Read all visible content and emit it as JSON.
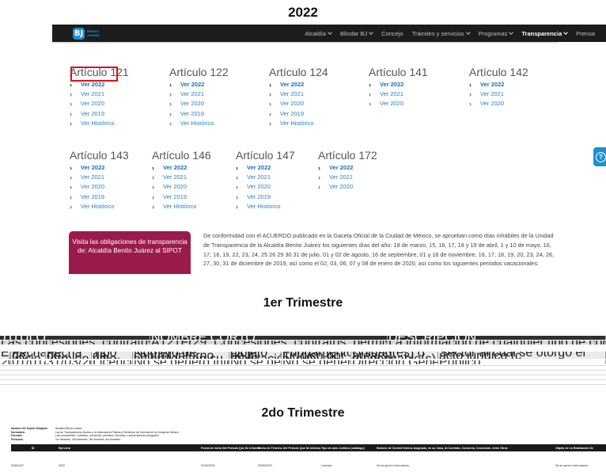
{
  "page": {
    "year_title": "2022"
  },
  "navbar": {
    "logo_mark": "BJ",
    "logo_text": "BENITO\nJUÁREZ",
    "items": [
      {
        "label": "Alcaldía",
        "dropdown": true
      },
      {
        "label": "Blindar BJ",
        "dropdown": true
      },
      {
        "label": "Concejo",
        "dropdown": false
      },
      {
        "label": "Trámites y servicios",
        "dropdown": true
      },
      {
        "label": "Programas",
        "dropdown": true
      },
      {
        "label": "Transparencia",
        "dropdown": true,
        "active": true
      },
      {
        "label": "Prensa",
        "dropdown": false
      }
    ]
  },
  "articles": [
    {
      "title": "Artículo 121",
      "links": [
        "Ver 2022",
        "Ver 2021",
        "Ver 2020",
        "Ver 2019",
        "Ver Histórico"
      ]
    },
    {
      "title": "Artículo 122",
      "links": [
        "Ver 2022",
        "Ver 2021",
        "Ver 2020",
        "Ver 2019",
        "Ver Histórico"
      ]
    },
    {
      "title": "Artículo 124",
      "links": [
        "Ver 2022",
        "Ver 2021",
        "Ver 2020",
        "Ver 2019",
        "Ver Histórico"
      ]
    },
    {
      "title": "Artículo 141",
      "links": [
        "Ver 2022",
        "Ver 2021",
        "Ver 2020"
      ]
    },
    {
      "title": "Artículo 142",
      "links": [
        "Ver 2022",
        "Ver 2021",
        "Ver 2020"
      ]
    },
    {
      "title": "Artículo 143",
      "links": [
        "Ver 2022",
        "Ver 2021",
        "Ver 2020",
        "Ver 2019",
        "Ver Histórico"
      ]
    },
    {
      "title": "Artículo 146",
      "links": [
        "Ver 2022",
        "Ver 2021",
        "Ver 2020",
        "Ver 2019",
        "Ver Histórico"
      ]
    },
    {
      "title": "Artículo 147",
      "links": [
        "Ver 2022",
        "Ver 2021",
        "Ver 2020",
        "Ver 2019",
        "Ver Histórico"
      ]
    },
    {
      "title": "Artículo 172",
      "links": [
        "Ver 2022",
        "Ver 2021",
        "Ver 2020"
      ]
    }
  ],
  "sipot": {
    "button_text": "Visita las obligaciones de transparencia de: Alcaldía Benito Juárez al SIPOT",
    "notice": "De conformidad con el ACUERDO publicado en la Gaceta Oficial de la Ciudad de México, se aprueban como días inhábiles de la Unidad de Transparencia de la Alcaldía Benito Juárez los siguientes días del año: 18 de marzo, 15, 16, 17, 18 y 19 de abril, 1 y 10 de mayo, 16, 17, 18, 19, 22, 23, 24, 25 26 29 30 31 de julio, 01 y 02 de agosto, 16 de septiembre, 01 y 18 de noviembre, 16, 17, 18, 19, 20, 23, 24, 26, 27, 30, 31 de diciembre de 2019, así como el 02, 03, 06, 07 y 08 de enero de 2020, así como los siguientes periodos vacacionales:"
  },
  "section_q1": {
    "title": "1er Trimestre",
    "row1": [
      "TÍTULO",
      "NOMBRE CORTO",
      "DESCRIPCIÓN"
    ],
    "row2": [
      "Las concesiones, contratos, convenios, permisos, licencias o autorizaciones otorgados",
      "A121Fr29_Concesiones, contratos, permisos",
      "La información de cualquier tipo de concesión, contrato, convenio, permiso, licencia o autorizaciones otorgados, de acuerdo con sus atribuciones, así"
    ],
    "headers": [
      "Ejercicio",
      "Fecha de inicio del periodo que se informa",
      "Fecha de término del periodo que se informa",
      "Tipo de acto jurídico (catálogo)",
      "Número de control interno asignado, en su caso, al contrato, convenio, concesión, entre otros",
      "Objeto de la realización del acto jurídico",
      "Fundamento jurídico por el cual se llevó a cabo el acto",
      "Unidad(es) o área(s) responsable(s) de instrumentación",
      "Sector al cual se otorgó el acto jurídico (c"
    ],
    "data_row": [
      "2022",
      "01/01/2022",
      "31/03/2022",
      "Licencia",
      "No se generó información",
      "No se generó información",
      "No se generó información",
      "Dirección General de Desarrollo Social",
      "Público"
    ]
  },
  "section_q2": {
    "title": "2do Trimestre",
    "meta": [
      {
        "k": "Nombre del Sujeto Obligado:",
        "v": "Alcaldía Benito Juárez"
      },
      {
        "k": "Normativa:",
        "v": "Ley de Transparencia, Acceso a la Información Pública y Rendición de Cuentas de la Ciudad de México"
      },
      {
        "k": "Formato:",
        "v": "Las concesiones, contratos, convenios, permisos, licencias o autorizaciones otorgados"
      },
      {
        "k": "Periodos:",
        "v": "1er trimestre, 2do trimestre, 3er trimestre, 4to trimestre"
      }
    ],
    "headers": [
      "ID",
      "Ejercicio",
      "Fecha de Inicio Del Periodo Que Se Informa",
      "Fecha de Término Del Periodo Que Se Informa",
      "Tipo de Acto Jurídico (catálogo)",
      "Número de Control Interno Asignado, en su Caso, Al Contrato, Convenio, Concesión, entre Otros",
      "Objeto de La Realización De"
    ],
    "data_row": [
      "51561407",
      "2022",
      "01/04/2022",
      "30/06/2022",
      "Licencia",
      "No se generó información",
      "No se generó información"
    ]
  }
}
